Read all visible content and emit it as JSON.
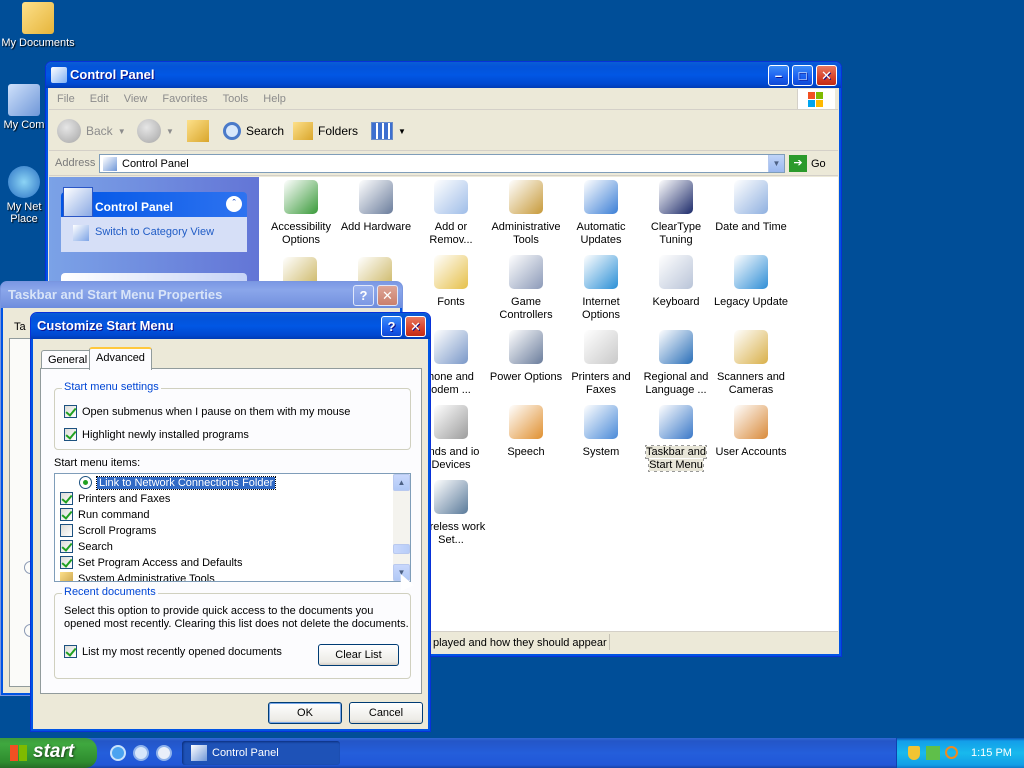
{
  "desktop": {
    "icons": [
      {
        "label": "My Documents"
      },
      {
        "label": "My Com"
      },
      {
        "label": "My Net Place"
      }
    ]
  },
  "control_panel": {
    "title": "Control Panel",
    "menu": [
      "File",
      "Edit",
      "View",
      "Favorites",
      "Tools",
      "Help"
    ],
    "toolbar": {
      "back": "Back",
      "search": "Search",
      "folders": "Folders"
    },
    "address_label": "Address",
    "address_value": "Control Panel",
    "go": "Go",
    "taskpane": {
      "title": "Control Panel",
      "link": "Switch to Category View"
    },
    "items": [
      "Accessibility Options",
      "Add Hardware",
      "Add or Remov...",
      "Administrative Tools",
      "Automatic Updates",
      "ClearType Tuning",
      "Date and Time",
      "",
      "",
      "Fonts",
      "Game Controllers",
      "Internet Options",
      "Keyboard",
      "Legacy Update",
      "",
      "",
      "hone and odem ...",
      "Power Options",
      "Printers and Faxes",
      "Regional and Language ...",
      "Scanners and Cameras",
      "",
      "",
      "unds and io Devices",
      "Speech",
      "System",
      "Taskbar and Start Menu",
      "User Accounts",
      "",
      "",
      "Wireless work Set...",
      "",
      "",
      "",
      ""
    ],
    "status": "played and how they should appear"
  },
  "taskbar_props": {
    "title": "Taskbar and Start Menu Properties",
    "tab_fragment": "Ta"
  },
  "customize": {
    "title": "Customize Start Menu",
    "tabs": [
      "General",
      "Advanced"
    ],
    "settings_legend": "Start menu settings",
    "settings": [
      {
        "label": "Open submenus when I pause on them with my mouse"
      },
      {
        "label": "Highlight newly installed programs"
      }
    ],
    "items_label": "Start menu items:",
    "items": [
      {
        "label": "Link to Network Connections Folder"
      },
      {
        "label": "Printers and Faxes"
      },
      {
        "label": "Run command"
      },
      {
        "label": "Scroll Programs"
      },
      {
        "label": "Search"
      },
      {
        "label": "Set Program Access and Defaults"
      },
      {
        "label": "System Administrative Tools"
      }
    ],
    "recent_legend": "Recent documents",
    "recent_desc": "Select this option to provide quick access to the documents you opened most recently.  Clearing this list does not delete the documents.",
    "recent_check": "List my most recently opened documents",
    "clear_list": "Clear List",
    "ok": "OK",
    "cancel": "Cancel"
  },
  "taskbar": {
    "start": "start",
    "task_label": "Control Panel",
    "clock": "1:15 PM"
  }
}
